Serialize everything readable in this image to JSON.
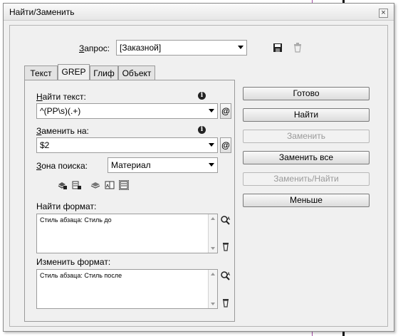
{
  "window": {
    "title": "Найти/Заменить",
    "close_glyph": "×"
  },
  "query": {
    "label": "Запрос:",
    "label_u": "З",
    "label_rest": "апрос:",
    "value": "[Заказной]"
  },
  "tabs": [
    {
      "label": "Текст",
      "active": false
    },
    {
      "label": "GREP",
      "active": true
    },
    {
      "label": "Глиф",
      "active": false
    },
    {
      "label": "Объект",
      "active": false
    }
  ],
  "find": {
    "label_u": "Н",
    "label_rest": "айти текст:",
    "value": "^(PP\\s)(.+)",
    "info_glyph": "i",
    "special_glyph": "@"
  },
  "replace": {
    "label_u": "З",
    "label_rest": "аменить на:",
    "value": "$2",
    "info_glyph": "i",
    "special_glyph": "@"
  },
  "search": {
    "label_u": "З",
    "label_rest": "она поиска:",
    "value": "Материал"
  },
  "find_format": {
    "label": "Найти формат:",
    "text": "Стиль абзаца: Стиль до"
  },
  "change_format": {
    "label": "Изменить формат:",
    "text": "Стиль абзаца: Стиль после"
  },
  "buttons": {
    "done": "Готово",
    "find": "Найти",
    "replace": "Заменить",
    "replace_all": "Заменить все",
    "replace_find": "Заменить/Найти",
    "less": "Меньше"
  },
  "icons": [
    "save-icon",
    "trash-icon",
    "include-locked-layers-icon",
    "include-locked-stories-icon",
    "include-hidden-layers-icon",
    "include-master-pages-icon",
    "include-footnotes-icon",
    "specify-attributes-icon",
    "clear-attributes-icon"
  ],
  "colors": {
    "guide_black": "#111111",
    "guide_purple": "#a349a4"
  }
}
